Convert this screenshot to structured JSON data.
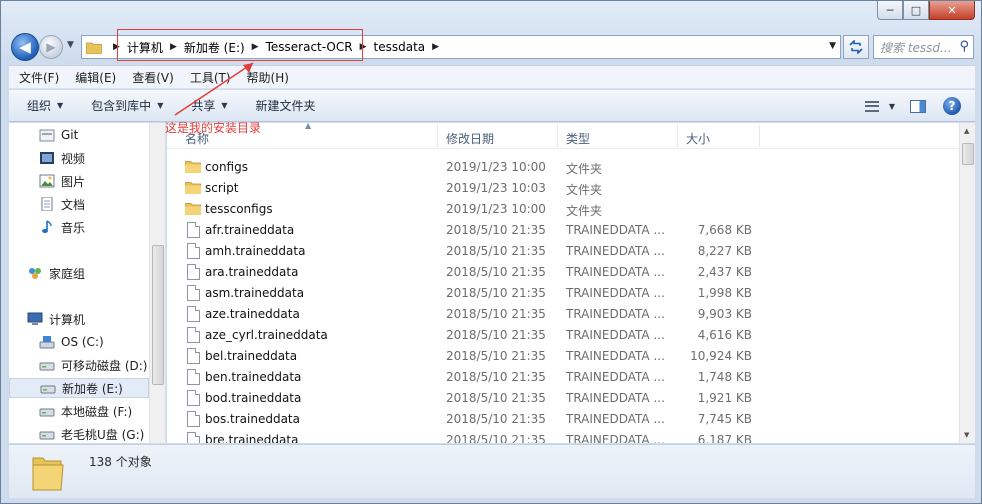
{
  "window": {
    "caption": {
      "min": "─",
      "max": "□",
      "close": "✕"
    }
  },
  "nav": {
    "back_icon": "arrow-left",
    "forward_icon": "arrow-right"
  },
  "address": {
    "crumbs": [
      "计算机",
      "新加卷 (E:)",
      "Tesseract-OCR",
      "tessdata"
    ]
  },
  "search": {
    "placeholder": "搜索 tessd..."
  },
  "annotation": {
    "text": "这是我的安装目录"
  },
  "menu": [
    "文件(F)",
    "编辑(E)",
    "查看(V)",
    "工具(T)",
    "帮助(H)"
  ],
  "toolbar": {
    "organize": "组织",
    "include_library": "包含到库中",
    "share": "共享",
    "new_folder": "新建文件夹"
  },
  "sidebar": {
    "items": [
      {
        "label": "Git",
        "icon": "git-folder-icon"
      },
      {
        "label": "视频",
        "icon": "video-library-icon"
      },
      {
        "label": "图片",
        "icon": "picture-library-icon"
      },
      {
        "label": "文档",
        "icon": "document-library-icon"
      },
      {
        "label": "音乐",
        "icon": "music-library-icon"
      },
      {
        "label": "家庭组",
        "icon": "homegroup-icon"
      },
      {
        "label": "计算机",
        "icon": "computer-icon"
      },
      {
        "label": "OS (C:)",
        "icon": "os-drive-icon"
      },
      {
        "label": "可移动磁盘 (D:)",
        "icon": "removable-drive-icon"
      },
      {
        "label": "新加卷 (E:)",
        "icon": "drive-icon"
      },
      {
        "label": "本地磁盘 (F:)",
        "icon": "drive-icon"
      },
      {
        "label": "老毛桃U盘 (G:)",
        "icon": "drive-icon"
      }
    ]
  },
  "columns": {
    "name": "名称",
    "date": "修改日期",
    "type": "类型",
    "size": "大小"
  },
  "files": [
    {
      "name": "configs",
      "date": "2019/1/23 10:00",
      "type": "文件夹",
      "size": "",
      "kind": "folder"
    },
    {
      "name": "script",
      "date": "2019/1/23 10:03",
      "type": "文件夹",
      "size": "",
      "kind": "folder"
    },
    {
      "name": "tessconfigs",
      "date": "2019/1/23 10:00",
      "type": "文件夹",
      "size": "",
      "kind": "folder"
    },
    {
      "name": "afr.traineddata",
      "date": "2018/5/10 21:35",
      "type": "TRAINEDDATA ...",
      "size": "7,668 KB",
      "kind": "file"
    },
    {
      "name": "amh.traineddata",
      "date": "2018/5/10 21:35",
      "type": "TRAINEDDATA ...",
      "size": "8,227 KB",
      "kind": "file"
    },
    {
      "name": "ara.traineddata",
      "date": "2018/5/10 21:35",
      "type": "TRAINEDDATA ...",
      "size": "2,437 KB",
      "kind": "file"
    },
    {
      "name": "asm.traineddata",
      "date": "2018/5/10 21:35",
      "type": "TRAINEDDATA ...",
      "size": "1,998 KB",
      "kind": "file"
    },
    {
      "name": "aze.traineddata",
      "date": "2018/5/10 21:35",
      "type": "TRAINEDDATA ...",
      "size": "9,903 KB",
      "kind": "file"
    },
    {
      "name": "aze_cyrl.traineddata",
      "date": "2018/5/10 21:35",
      "type": "TRAINEDDATA ...",
      "size": "4,616 KB",
      "kind": "file"
    },
    {
      "name": "bel.traineddata",
      "date": "2018/5/10 21:35",
      "type": "TRAINEDDATA ...",
      "size": "10,924 KB",
      "kind": "file"
    },
    {
      "name": "ben.traineddata",
      "date": "2018/5/10 21:35",
      "type": "TRAINEDDATA ...",
      "size": "1,748 KB",
      "kind": "file"
    },
    {
      "name": "bod.traineddata",
      "date": "2018/5/10 21:35",
      "type": "TRAINEDDATA ...",
      "size": "1,921 KB",
      "kind": "file"
    },
    {
      "name": "bos.traineddata",
      "date": "2018/5/10 21:35",
      "type": "TRAINEDDATA ...",
      "size": "7,745 KB",
      "kind": "file"
    },
    {
      "name": "bre.traineddata",
      "date": "2018/5/10 21:35",
      "type": "TRAINEDDATA ...",
      "size": "6,187 KB",
      "kind": "file"
    }
  ],
  "status": {
    "count_text": "138 个对象"
  },
  "colors": {
    "accent": "#1f5fb8",
    "annotation": "#e23d3d"
  }
}
